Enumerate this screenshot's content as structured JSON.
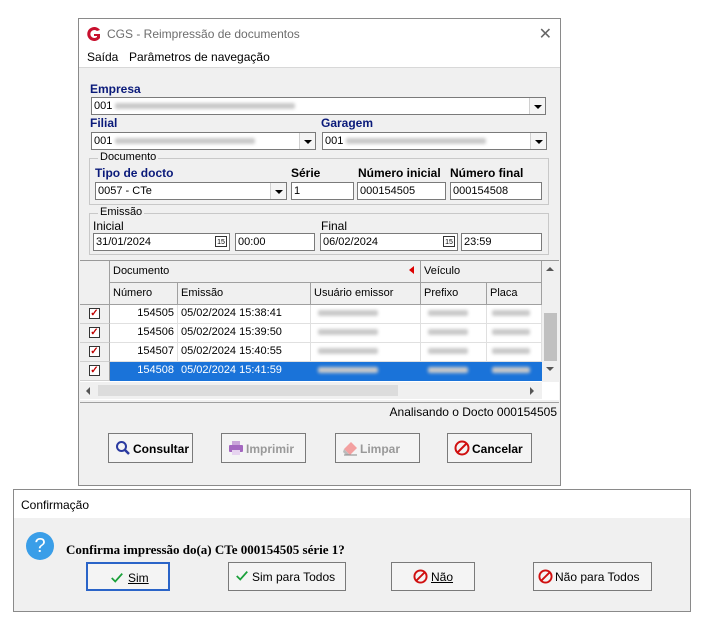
{
  "window": {
    "title": "CGS - Reimpressão de documentos",
    "close": "✕"
  },
  "menu": {
    "items": [
      "Saída",
      "Parâmetros de navegação"
    ]
  },
  "empresa": {
    "label": "Empresa",
    "value": "001"
  },
  "filial": {
    "label": "Filial",
    "value": "001"
  },
  "garagem": {
    "label": "Garagem",
    "value": "001"
  },
  "documento": {
    "group": "Documento",
    "tipo_label": "Tipo de docto",
    "tipo_value": "0057 - CTe",
    "serie_label": "Série",
    "serie_value": "1",
    "num_ini_label": "Número inicial",
    "num_ini_value": "000154505",
    "num_fin_label": "Número final",
    "num_fin_value": "000154508"
  },
  "emissao": {
    "group": "Emissão",
    "inicial_label": "Inicial",
    "inicial_date": "31/01/2024",
    "inicial_time": "00:00",
    "final_label": "Final",
    "final_date": "06/02/2024",
    "final_time": "23:59",
    "cal_icon": "15"
  },
  "grid": {
    "group_headers": [
      "Documento",
      "Veículo"
    ],
    "columns": [
      "Número",
      "Emissão",
      "Usuário emissor",
      "Prefixo",
      "Placa"
    ],
    "rows": [
      {
        "numero": "154505",
        "emissao": "05/02/2024 15:38:41",
        "checked": true,
        "selected": false
      },
      {
        "numero": "154506",
        "emissao": "05/02/2024 15:39:50",
        "checked": true,
        "selected": false
      },
      {
        "numero": "154507",
        "emissao": "05/02/2024 15:40:55",
        "checked": true,
        "selected": false
      },
      {
        "numero": "154508",
        "emissao": "05/02/2024 15:41:59",
        "checked": true,
        "selected": true
      }
    ]
  },
  "status": "Analisando o Docto 000154505",
  "buttons": {
    "consultar": "Consultar",
    "imprimir": "Imprimir",
    "limpar": "Limpar",
    "cancelar": "Cancelar"
  },
  "dialog": {
    "title": "Confirmação",
    "message": "Confirma impressão do(a) CTe 000154505 série 1?",
    "buttons": {
      "sim": "Sim",
      "sim_todos": "Sim para Todos",
      "nao": "Não",
      "nao_todos": "Não para Todos"
    }
  },
  "colors": {
    "accent": "#1a73d9",
    "brand": "#c8102e",
    "label": "#0a1a7a"
  }
}
